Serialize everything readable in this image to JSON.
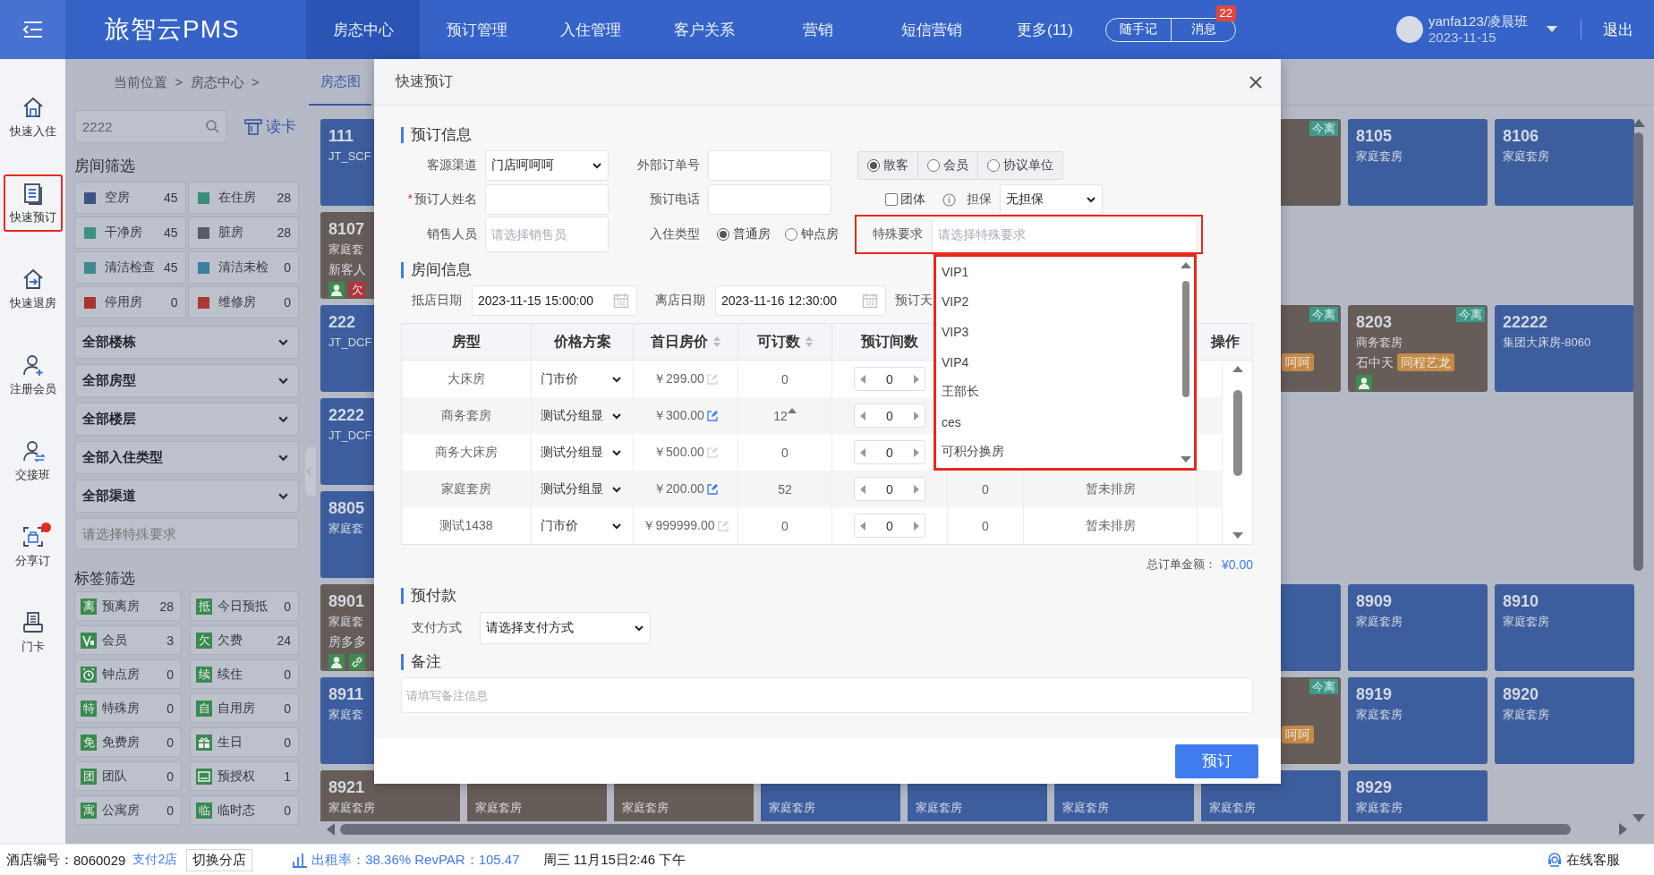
{
  "topbar": {
    "logo": "旅智云PMS",
    "nav": [
      {
        "label": "房态中心",
        "selected": true
      },
      {
        "label": "预订管理",
        "selected": false
      },
      {
        "label": "入住管理",
        "selected": false
      },
      {
        "label": "客户关系",
        "selected": false
      },
      {
        "label": "营销",
        "selected": false
      },
      {
        "label": "短信营销",
        "selected": false
      },
      {
        "label": "更多(11)",
        "selected": false
      }
    ],
    "quick": [
      {
        "label": "随手记"
      },
      {
        "label": "消息",
        "badge": "22"
      }
    ],
    "user": "yanfa123/凌晨班",
    "date": "2023-11-15",
    "logout": "退出"
  },
  "rail": [
    {
      "label": "快速入住",
      "highlighted": false,
      "dot": false
    },
    {
      "label": "快速预订",
      "highlighted": true,
      "dot": false
    },
    {
      "label": "快速退房",
      "highlighted": false,
      "dot": false
    },
    {
      "label": "注册会员",
      "highlighted": false,
      "dot": false
    },
    {
      "label": "交接班",
      "highlighted": false,
      "dot": false
    },
    {
      "label": "分享订",
      "highlighted": false,
      "dot": true
    },
    {
      "label": "门卡",
      "highlighted": false,
      "dot": false
    }
  ],
  "filter": {
    "breadcrumb": "当前位置  >  房态中心  >",
    "search": {
      "placeholder": "2222"
    },
    "card_reader": "读卡",
    "room_title": "房间筛选",
    "status": [
      {
        "label": "空房",
        "count": "45",
        "color": "#3f5486"
      },
      {
        "label": "在住房",
        "count": "28",
        "color": "#3c8c78"
      },
      {
        "label": "干净房",
        "count": "45",
        "color": "#3d9183"
      },
      {
        "label": "脏房",
        "count": "28",
        "color": "#575c68"
      },
      {
        "label": "清洁检查",
        "count": "45",
        "color": "#3d8a8f"
      },
      {
        "label": "清洁未检",
        "count": "0",
        "color": "#3a7f9f"
      },
      {
        "label": "停用房",
        "count": "0",
        "color": "#a8352d"
      },
      {
        "label": "维修房",
        "count": "0",
        "color": "#a83a33"
      }
    ],
    "selects": [
      "全部楼栋",
      "全部房型",
      "全部楼层",
      "全部入住类型",
      "全部渠道"
    ],
    "special_placeholder": "请选择特殊要求",
    "tag_title": "标签筛选",
    "tags": [
      {
        "kind": "letter",
        "icon_text": "离",
        "label": "预离房",
        "count": "28"
      },
      {
        "kind": "letter",
        "icon_text": "抵",
        "label": "今日预抵",
        "count": "0"
      },
      {
        "kind": "vip",
        "label": "会员",
        "count": "3"
      },
      {
        "kind": "letter",
        "icon_text": "欠",
        "label": "欠费",
        "count": "24"
      },
      {
        "kind": "clock",
        "label": "钟点房",
        "count": "0"
      },
      {
        "kind": "letter",
        "icon_text": "续",
        "label": "续住",
        "count": "0"
      },
      {
        "kind": "letter",
        "icon_text": "特",
        "label": "特殊房",
        "count": "0"
      },
      {
        "kind": "letter",
        "icon_text": "自",
        "label": "自用房",
        "count": "0"
      },
      {
        "kind": "letter",
        "icon_text": "免",
        "label": "免费房",
        "count": "0"
      },
      {
        "kind": "gift",
        "label": "生日",
        "count": "0"
      },
      {
        "kind": "letter",
        "icon_text": "团",
        "label": "团队",
        "count": "0"
      },
      {
        "kind": "card",
        "label": "预授权",
        "count": "1"
      },
      {
        "kind": "letter",
        "icon_text": "寓",
        "label": "公寓房",
        "count": "0"
      },
      {
        "kind": "letter",
        "icon_text": "临",
        "label": "临时态",
        "count": "0"
      }
    ]
  },
  "rooms": {
    "tab": "房态图",
    "rows": [
      {
        "slots": [
          {
            "kind": "card",
            "color": "#3d5e9e",
            "number": "111",
            "room_type": "JT_SCF"
          },
          {
            "kind": "empty"
          },
          {
            "kind": "empty"
          },
          {
            "kind": "empty"
          },
          {
            "kind": "empty"
          },
          {
            "kind": "empty"
          },
          {
            "kind": "edge",
            "color": "#675d58",
            "tag": "今离"
          },
          {
            "kind": "card",
            "color": "#3d5e9e",
            "number": "8105",
            "room_type": "家庭套房"
          },
          {
            "kind": "card",
            "color": "#3d5e9e",
            "number": "8106",
            "room_type": "家庭套房"
          }
        ]
      },
      {
        "slots": [
          {
            "kind": "card",
            "color": "#675d58",
            "number": "8107",
            "room_type": "家庭套",
            "guest": "新客人",
            "badges": [
              {
                "kind": "guest",
                "color": "#3e8a4f"
              },
              {
                "kind": "letter",
                "text": "欠",
                "color": "#b2343a"
              }
            ]
          },
          {
            "kind": "empty"
          },
          {
            "kind": "empty"
          },
          {
            "kind": "empty"
          },
          {
            "kind": "empty"
          },
          {
            "kind": "empty"
          },
          {
            "kind": "empty"
          },
          {
            "kind": "empty"
          },
          {
            "kind": "empty"
          }
        ]
      },
      {
        "slots": [
          {
            "kind": "card",
            "color": "#3d5e9e",
            "number": "222",
            "room_type": "JT_DCF"
          },
          {
            "kind": "empty"
          },
          {
            "kind": "empty"
          },
          {
            "kind": "empty"
          },
          {
            "kind": "empty"
          },
          {
            "kind": "empty"
          },
          {
            "kind": "edge",
            "color": "#675d58",
            "tag": "今离",
            "channel": "呵呵"
          },
          {
            "kind": "card",
            "color": "#675d58",
            "number": "8203",
            "room_type": "商务套房",
            "guest": "石中天",
            "channel": "同程艺龙",
            "tag": "今离",
            "badges": [
              {
                "kind": "guest",
                "color": "#3e8a4f"
              }
            ]
          },
          {
            "kind": "card",
            "color": "#3d5e9e",
            "number": "22222",
            "room_type": "集团大床房-8060"
          }
        ]
      },
      {
        "slots": [
          {
            "kind": "card",
            "color": "#3d5e9e",
            "number": "2222",
            "room_type": "JT_DCF"
          },
          {
            "kind": "empty"
          },
          {
            "kind": "empty"
          },
          {
            "kind": "empty"
          },
          {
            "kind": "empty"
          },
          {
            "kind": "empty"
          },
          {
            "kind": "empty"
          },
          {
            "kind": "empty"
          },
          {
            "kind": "empty"
          }
        ]
      },
      {
        "slots": [
          {
            "kind": "card",
            "color": "#3d5e9e",
            "number": "8805",
            "room_type": "家庭套"
          },
          {
            "kind": "empty"
          },
          {
            "kind": "empty"
          },
          {
            "kind": "empty"
          },
          {
            "kind": "empty"
          },
          {
            "kind": "empty"
          },
          {
            "kind": "empty"
          },
          {
            "kind": "empty"
          },
          {
            "kind": "empty"
          }
        ]
      },
      {
        "slots": [
          {
            "kind": "card",
            "color": "#675d58",
            "number": "8901",
            "room_type": "家庭套",
            "guest": "房多多",
            "badges": [
              {
                "kind": "guest",
                "color": "#3e8a4f"
              },
              {
                "kind": "link",
                "color": "#3e8a4f"
              }
            ]
          },
          {
            "kind": "empty"
          },
          {
            "kind": "empty"
          },
          {
            "kind": "empty"
          },
          {
            "kind": "empty"
          },
          {
            "kind": "empty"
          },
          {
            "kind": "edge",
            "color": "#3d5e9e"
          },
          {
            "kind": "card",
            "color": "#3d5e9e",
            "number": "8909",
            "room_type": "家庭套房"
          },
          {
            "kind": "card",
            "color": "#3d5e9e",
            "number": "8910",
            "room_type": "家庭套房"
          }
        ]
      },
      {
        "slots": [
          {
            "kind": "card",
            "color": "#3d5e9e",
            "number": "8911",
            "room_type": "家庭套"
          },
          {
            "kind": "empty"
          },
          {
            "kind": "empty"
          },
          {
            "kind": "empty"
          },
          {
            "kind": "empty"
          },
          {
            "kind": "empty"
          },
          {
            "kind": "edge",
            "color": "#675d58",
            "tag": "今离",
            "channel": "呵呵"
          },
          {
            "kind": "card",
            "color": "#3d5e9e",
            "number": "8919",
            "room_type": "家庭套房"
          },
          {
            "kind": "card",
            "color": "#3d5e9e",
            "number": "8920",
            "room_type": "家庭套房"
          }
        ]
      },
      {
        "slots": [
          {
            "kind": "card",
            "color": "#675d58",
            "number": "8921",
            "room_type": "家庭套房"
          },
          {
            "kind": "card",
            "color": "#675d58",
            "room_type": "家庭套房"
          },
          {
            "kind": "card",
            "color": "#675d58",
            "room_type": "家庭套房"
          },
          {
            "kind": "card",
            "color": "#3d5e9e",
            "room_type": "家庭套房"
          },
          {
            "kind": "card",
            "color": "#3d5e9e",
            "room_type": "家庭套房"
          },
          {
            "kind": "card",
            "color": "#3d5e9e",
            "room_type": "家庭套房"
          },
          {
            "kind": "card",
            "color": "#3d5e9e",
            "room_type": "家庭套房"
          },
          {
            "kind": "card",
            "color": "#3d5e9e",
            "number": "8929",
            "room_type": "家庭套房"
          },
          {
            "kind": "empty"
          }
        ]
      }
    ]
  },
  "modal": {
    "title": "快速预订",
    "booking_title": "预订信息",
    "channel": {
      "label": "客源渠道",
      "value": "门店呵呵呵"
    },
    "external_no": {
      "label": "外部订单号"
    },
    "guest_types": [
      {
        "label": "散客",
        "selected": true
      },
      {
        "label": "会员",
        "selected": false
      },
      {
        "label": "协议单位",
        "selected": false
      }
    ],
    "booker": {
      "label": "预订人姓名",
      "required_mark": "*"
    },
    "phone": {
      "label": "预订电话"
    },
    "group": {
      "label": "团体",
      "checked": false
    },
    "guarantee": {
      "label": "担保",
      "value": "无担保"
    },
    "sales": {
      "label": "销售人员",
      "placeholder": "请选择销售员"
    },
    "checkin_type": {
      "label": "入住类型",
      "options": [
        {
          "label": "普通房",
          "selected": true
        },
        {
          "label": "钟点房",
          "selected": false
        }
      ]
    },
    "special": {
      "label": "特殊要求",
      "placeholder": "请选择特殊要求",
      "highlighted": true
    },
    "special_options": {
      "highlighted": true,
      "items": [
        "VIP1",
        "VIP2",
        "VIP3",
        "VIP4",
        "王部长",
        "ces",
        "可积分换房"
      ]
    },
    "room_title": "房间信息",
    "arrival": {
      "label": "抵店日期",
      "value": "2023-11-15 15:00:00"
    },
    "departure": {
      "label": "离店日期",
      "value": "2023-11-16 12:30:00"
    },
    "nights_label": "预订天",
    "table": {
      "columns": [
        {
          "label": "房型",
          "sortable": false
        },
        {
          "label": "价格方案",
          "sortable": false
        },
        {
          "label": "首日房价",
          "sortable": true
        },
        {
          "label": "可订数",
          "sortable": true
        },
        {
          "label": "预订间数",
          "sortable": false
        },
        {
          "label": "操作",
          "sortable": false
        }
      ],
      "rows": [
        {
          "room_type": "大床房",
          "rate_plan": "门市价",
          "price": "￥299.00",
          "price_editable": false,
          "available": "0",
          "available_caret": false,
          "quantity": "0"
        },
        {
          "room_type": "商务套房",
          "rate_plan": "测试分组显",
          "price": "￥300.00",
          "price_editable": true,
          "available": "12",
          "available_caret": true,
          "quantity": "0"
        },
        {
          "room_type": "商务大床房",
          "rate_plan": "测试分组显",
          "price": "￥500.00",
          "price_editable": false,
          "available": "0",
          "available_caret": false,
          "quantity": "0"
        },
        {
          "room_type": "家庭套房",
          "rate_plan": "测试分组显",
          "price": "￥200.00",
          "price_editable": true,
          "available": "52",
          "available_caret": false,
          "quantity": "0",
          "column_6": "0",
          "column_7": "暂未排房"
        },
        {
          "room_type": "测试1438",
          "rate_plan": "门市价",
          "price": "￥999999.00",
          "price_editable": false,
          "available": "0",
          "available_caret": false,
          "quantity": "0",
          "column_6": "0",
          "column_7": "暂未排房"
        }
      ]
    },
    "total_label": "总订单金额：",
    "total": "¥0.00",
    "prepay_title": "预付款",
    "payment": {
      "label": "支付方式",
      "value": "请选择支付方式"
    },
    "remark_title": "备注",
    "remark": {
      "placeholder": "请填写备注信息"
    },
    "submit": "预订"
  },
  "status_bar": {
    "hotel_label": "酒店编号：",
    "hotel_no": "8060029",
    "pay_store": "支付2店",
    "switch": "切换分店",
    "occupancy": "出租率：38.36% RevPAR：105.47",
    "datetime": "周三 11月15日2:46 下午",
    "support": "在线客服"
  }
}
